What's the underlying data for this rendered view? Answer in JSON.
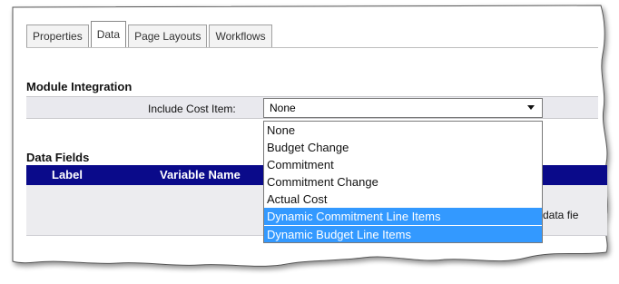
{
  "tabs": [
    {
      "label": "Properties",
      "active": false
    },
    {
      "label": "Data",
      "active": true
    },
    {
      "label": "Page Layouts",
      "active": false
    },
    {
      "label": "Workflows",
      "active": false
    }
  ],
  "module_integration": {
    "title": "Module Integration",
    "include_label": "Include Cost Item:",
    "selected": "None",
    "options": [
      "None",
      "Budget Change",
      "Commitment",
      "Commitment Change",
      "Actual Cost",
      "Dynamic Commitment Line Items",
      "Dynamic Budget Line Items"
    ]
  },
  "data_fields": {
    "title": "Data Fields",
    "columns": [
      "Label",
      "Variable Name"
    ],
    "empty_text": "data fie"
  },
  "colors": {
    "header_bg": "#0a0a8a",
    "highlight": "#3399ff"
  }
}
